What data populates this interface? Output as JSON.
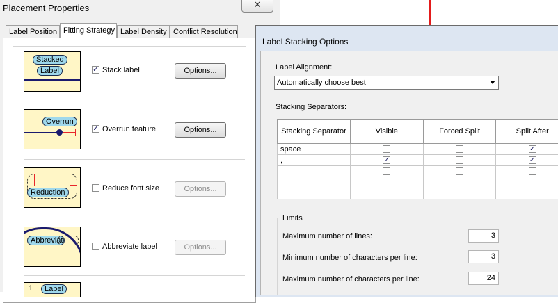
{
  "placement_dialog": {
    "title": "Placement Properties",
    "close_glyph": "✕",
    "tabs": [
      {
        "label": "Label Position",
        "active": false
      },
      {
        "label": "Fitting Strategy",
        "active": true
      },
      {
        "label": "Label Density",
        "active": false
      },
      {
        "label": "Conflict Resolution",
        "active": false
      }
    ],
    "strategies": [
      {
        "preview_text": [
          "Stacked",
          "Label"
        ],
        "checkbox_label": "Stack label",
        "checked": true,
        "button_label": "Options...",
        "button_enabled": true
      },
      {
        "preview_text": [
          "Overrun"
        ],
        "checkbox_label": "Overrun feature",
        "checked": true,
        "button_label": "Options...",
        "button_enabled": true
      },
      {
        "preview_text": [
          "Reduction"
        ],
        "checkbox_label": "Reduce font size",
        "checked": false,
        "button_label": "Options...",
        "button_enabled": false
      },
      {
        "preview_text": [
          "Abbreviation"
        ],
        "checkbox_label": "Abbreviate label",
        "checked": false,
        "button_label": "Options...",
        "button_enabled": false
      },
      {
        "preview_text": [
          "1",
          "Label"
        ]
      }
    ]
  },
  "stacking_dialog": {
    "title": "Label Stacking Options",
    "alignment_label": "Label Alignment:",
    "alignment_value": "Automatically choose best",
    "separators_label": "Stacking Separators:",
    "columns": [
      "Stacking Separator",
      "Visible",
      "Forced Split",
      "Split After"
    ],
    "rows": [
      {
        "separator": "space",
        "visible": false,
        "forced_split": false,
        "split_after": true
      },
      {
        "separator": ",",
        "visible": true,
        "forced_split": false,
        "split_after": true
      },
      {
        "separator": "",
        "visible": false,
        "forced_split": false,
        "split_after": false
      },
      {
        "separator": "",
        "visible": false,
        "forced_split": false,
        "split_after": false
      },
      {
        "separator": "",
        "visible": false,
        "forced_split": false,
        "split_after": false
      }
    ],
    "limits_label": "Limits",
    "limits": [
      {
        "label": "Maximum number of lines:",
        "value": "3"
      },
      {
        "label": "Minimum number of characters per line:",
        "value": "3"
      },
      {
        "label": "Maximum number of characters per line:",
        "value": "24"
      }
    ]
  },
  "colors": {
    "preview_fill": "#fff6c6",
    "pill_fill": "#9fd8ec",
    "line_dark": "#1a1a6e",
    "accent_red": "#e8262b"
  }
}
